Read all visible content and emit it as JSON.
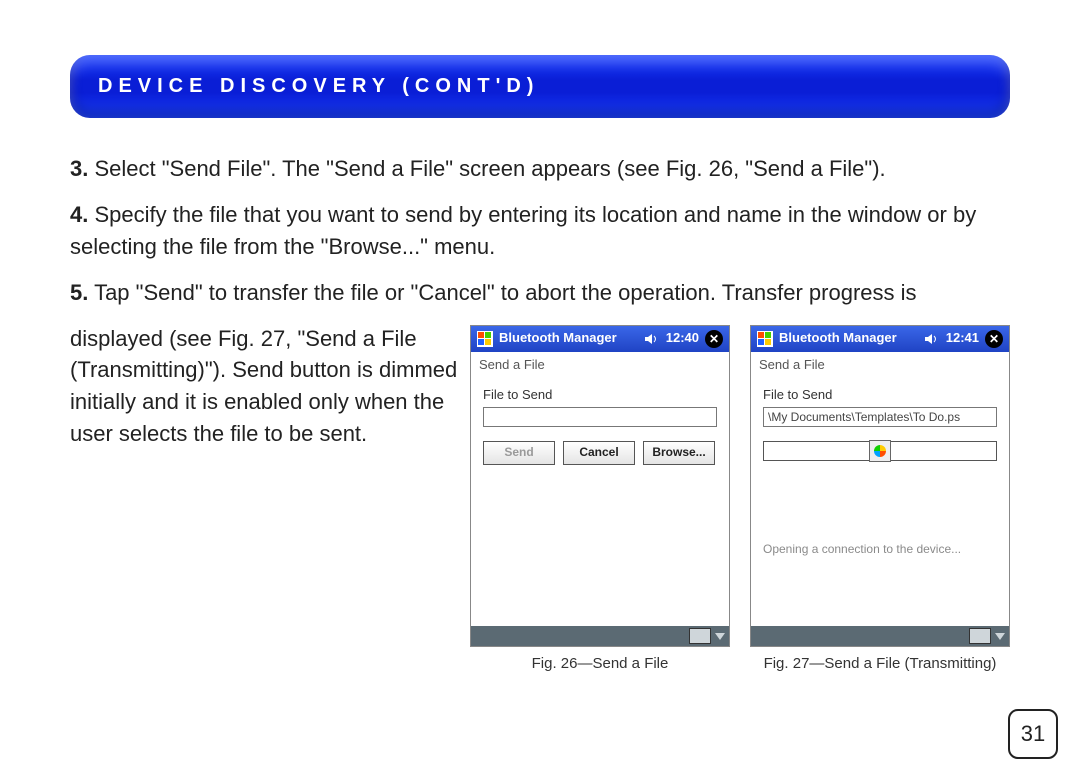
{
  "banner": {
    "title": "DEVICE DISCOVERY (CONT'D)"
  },
  "steps": {
    "s3": {
      "num": "3.",
      "text": " Select \"Send File\". The \"Send a File\" screen appears (see Fig. 26, \"Send a File\")."
    },
    "s4": {
      "num": "4.",
      "text": " Specify the file that you want to send by entering its location and name in the window or by selecting the file from the \"Browse...\" menu."
    },
    "s5": {
      "num": "5.",
      "text_a": " Tap \"Send\" to transfer the file or \"Cancel\" to abort the operation. Transfer progress is",
      "text_b": "displayed (see Fig. 27, \"Send a File (Transmitting)\"). Send button is dimmed initially and it is enabled only when the user selects the file to be sent."
    }
  },
  "fig26": {
    "titlebar": "Bluetooth Manager",
    "clock": "12:40",
    "subtitle": "Send a File",
    "field_label": "File to Send",
    "file_value": "",
    "buttons": {
      "send": "Send",
      "cancel": "Cancel",
      "browse": "Browse..."
    },
    "caption": "Fig. 26—Send a File"
  },
  "fig27": {
    "titlebar": "Bluetooth Manager",
    "clock": "12:41",
    "subtitle": "Send a File",
    "field_label": "File to Send",
    "file_value": "\\My Documents\\Templates\\To Do.ps",
    "status": "Opening a connection to the device...",
    "caption": "Fig. 27—Send a File (Transmitting)"
  },
  "page_number": "31"
}
